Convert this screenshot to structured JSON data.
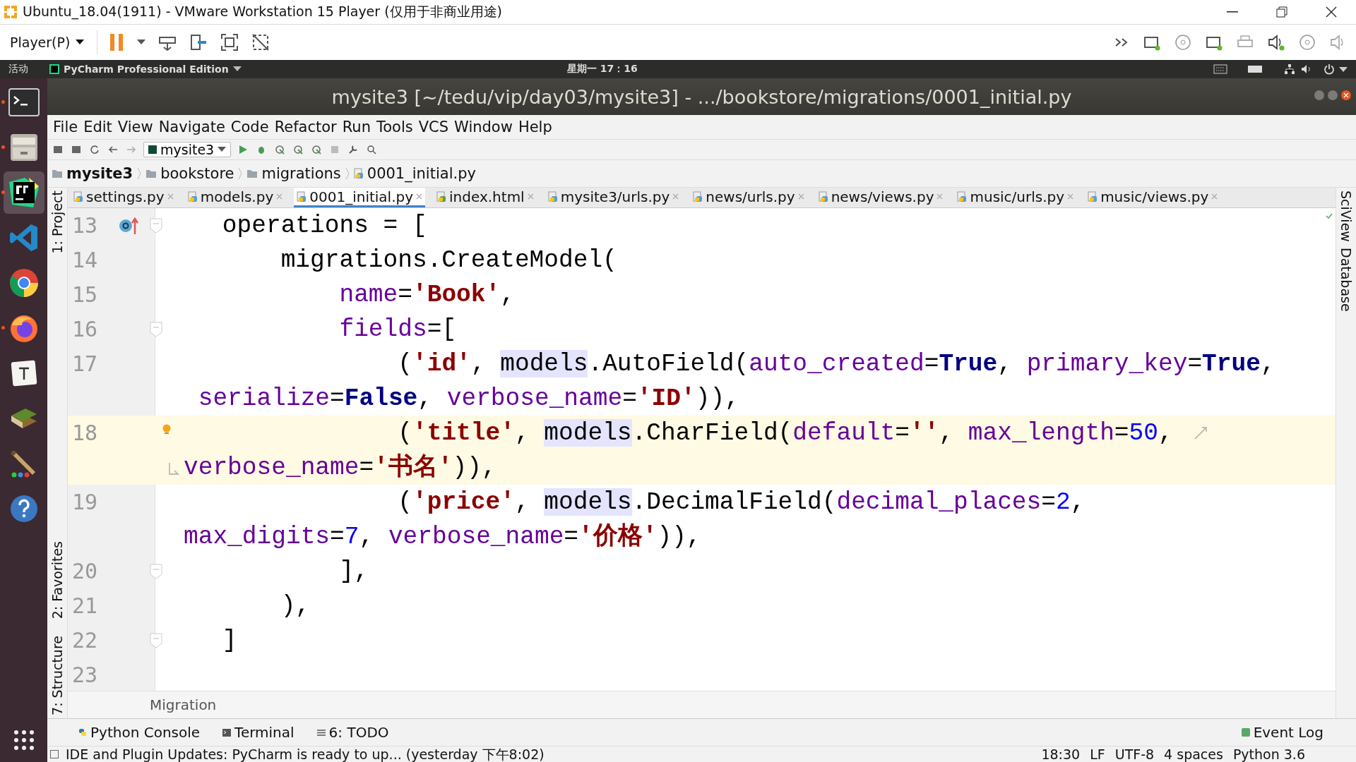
{
  "vm_window": {
    "title": "Ubuntu_18.04(1911) - VMware Workstation 15 Player (仅用于非商业用途)",
    "player_menu": "Player(P)",
    "paused": true
  },
  "ubuntu_bar": {
    "activities": "活动",
    "app_menu": "PyCharm Professional Edition",
    "clock": "星期一 17：16"
  },
  "dock": [
    {
      "kind": "terminal",
      "running": true,
      "selected": false
    },
    {
      "kind": "files",
      "running": true,
      "selected": false
    },
    {
      "kind": "pycharm",
      "running": true,
      "selected": true
    },
    {
      "kind": "vscode",
      "running": false,
      "selected": false
    },
    {
      "kind": "chrome",
      "running": false,
      "selected": false
    },
    {
      "kind": "firefox",
      "running": true,
      "selected": false
    },
    {
      "kind": "typora",
      "running": false,
      "selected": false
    },
    {
      "kind": "books",
      "running": false,
      "selected": false
    },
    {
      "kind": "brush",
      "running": false,
      "selected": false
    },
    {
      "kind": "help",
      "running": false,
      "selected": false
    }
  ],
  "ide": {
    "title": "mysite3 [~/tedu/vip/day03/mysite3] - .../bookstore/migrations/0001_initial.py",
    "menu": [
      "File",
      "Edit",
      "View",
      "Navigate",
      "Code",
      "Refactor",
      "Run",
      "Tools",
      "VCS",
      "Window",
      "Help"
    ],
    "run_config": "mysite3",
    "breadcrumb": [
      "mysite3",
      "bookstore",
      "migrations",
      "0001_initial.py"
    ],
    "tabs": [
      {
        "label": "settings.py",
        "selected": false
      },
      {
        "label": "models.py",
        "selected": false
      },
      {
        "label": "0001_initial.py",
        "selected": true
      },
      {
        "label": "index.html",
        "selected": false
      },
      {
        "label": "mysite3/urls.py",
        "selected": false
      },
      {
        "label": "news/urls.py",
        "selected": false
      },
      {
        "label": "news/views.py",
        "selected": false
      },
      {
        "label": "music/urls.py",
        "selected": false
      },
      {
        "label": "music/views.py",
        "selected": false
      }
    ],
    "left_tools": [
      "1: Project",
      "2: Favorites",
      "7: Structure"
    ],
    "right_tools": [
      "SciView",
      "Database"
    ],
    "lines": [
      {
        "number": "13",
        "current": false,
        "fold": true,
        "rows": [
          {
            "tokens": [
              {
                "kind": "text",
                "text": "    operations = ["
              }
            ]
          }
        ]
      },
      {
        "number": "14",
        "current": false,
        "fold": false,
        "rows": [
          {
            "tokens": [
              {
                "kind": "text",
                "text": "        migrations.CreateModel("
              }
            ]
          }
        ]
      },
      {
        "number": "15",
        "current": false,
        "fold": false,
        "rows": [
          {
            "tokens": [
              {
                "kind": "param",
                "text": "            name"
              },
              {
                "kind": "text",
                "text": "="
              },
              {
                "kind": "string",
                "text": "'Book'"
              },
              {
                "kind": "text",
                "text": ","
              }
            ]
          }
        ]
      },
      {
        "number": "16",
        "current": false,
        "fold": true,
        "rows": [
          {
            "tokens": [
              {
                "kind": "param",
                "text": "            fields"
              },
              {
                "kind": "text",
                "text": "=["
              }
            ]
          }
        ]
      },
      {
        "number": "17",
        "current": false,
        "fold": false,
        "rows": [
          {
            "tokens": [
              {
                "kind": "text",
                "text": "                ("
              },
              {
                "kind": "string",
                "text": "'id'"
              },
              {
                "kind": "text",
                "text": ", "
              },
              {
                "kind": "usage",
                "text": "models"
              },
              {
                "kind": "text",
                "text": ".AutoField("
              },
              {
                "kind": "param",
                "text": "auto_created"
              },
              {
                "kind": "text",
                "text": "="
              },
              {
                "kind": "constant",
                "text": "True"
              },
              {
                "kind": "text",
                "text": ", "
              },
              {
                "kind": "param",
                "text": "primary_key"
              },
              {
                "kind": "text",
                "text": "="
              },
              {
                "kind": "constant",
                "text": "True"
              },
              {
                "kind": "text",
                "text": ","
              }
            ]
          },
          {
            "tokens": [
              {
                "kind": "param",
                "text": " serialize"
              },
              {
                "kind": "text",
                "text": "="
              },
              {
                "kind": "constant",
                "text": "False"
              },
              {
                "kind": "text",
                "text": ", "
              },
              {
                "kind": "param",
                "text": "verbose_name"
              },
              {
                "kind": "text",
                "text": "="
              },
              {
                "kind": "string",
                "text": "'ID'"
              },
              {
                "kind": "text",
                "text": ")),"
              }
            ]
          }
        ]
      },
      {
        "number": "18",
        "current": true,
        "fold": false,
        "rows": [
          {
            "tokens": [
              {
                "kind": "text",
                "text": "                ("
              },
              {
                "kind": "string",
                "text": "'title'"
              },
              {
                "kind": "text",
                "text": ", "
              },
              {
                "kind": "usage",
                "text": "models"
              },
              {
                "kind": "text",
                "text": ".CharField("
              },
              {
                "kind": "param",
                "text": "default"
              },
              {
                "kind": "text",
                "text": "="
              },
              {
                "kind": "string",
                "text": "''"
              },
              {
                "kind": "text",
                "text": ", "
              },
              {
                "kind": "param",
                "text": "max_length"
              },
              {
                "kind": "text",
                "text": "="
              },
              {
                "kind": "number",
                "text": "50"
              },
              {
                "kind": "text",
                "text": ","
              }
            ]
          },
          {
            "tokens": [
              {
                "kind": "param",
                "text": "verbose_name"
              },
              {
                "kind": "text",
                "text": "="
              },
              {
                "kind": "string",
                "text": "'书名'"
              },
              {
                "kind": "text",
                "text": ")),"
              }
            ]
          }
        ]
      },
      {
        "number": "19",
        "current": false,
        "fold": false,
        "rows": [
          {
            "tokens": [
              {
                "kind": "text",
                "text": "                ("
              },
              {
                "kind": "string",
                "text": "'price'"
              },
              {
                "kind": "text",
                "text": ", "
              },
              {
                "kind": "usage",
                "text": "models"
              },
              {
                "kind": "text",
                "text": ".DecimalField("
              },
              {
                "kind": "param",
                "text": "decimal_places"
              },
              {
                "kind": "text",
                "text": "="
              },
              {
                "kind": "number",
                "text": "2"
              },
              {
                "kind": "text",
                "text": ","
              }
            ]
          },
          {
            "tokens": [
              {
                "kind": "param",
                "text": "max_digits"
              },
              {
                "kind": "text",
                "text": "="
              },
              {
                "kind": "number",
                "text": "7"
              },
              {
                "kind": "text",
                "text": ", "
              },
              {
                "kind": "param",
                "text": "verbose_name"
              },
              {
                "kind": "text",
                "text": "="
              },
              {
                "kind": "string",
                "text": "'价格'"
              },
              {
                "kind": "text",
                "text": ")),"
              }
            ]
          }
        ]
      },
      {
        "number": "20",
        "current": false,
        "fold": true,
        "rows": [
          {
            "tokens": [
              {
                "kind": "text",
                "text": "            ],"
              }
            ]
          }
        ]
      },
      {
        "number": "21",
        "current": false,
        "fold": false,
        "rows": [
          {
            "tokens": [
              {
                "kind": "text",
                "text": "        ),"
              }
            ]
          }
        ]
      },
      {
        "number": "22",
        "current": false,
        "fold": true,
        "rows": [
          {
            "tokens": [
              {
                "kind": "text",
                "text": "    ]"
              }
            ]
          }
        ]
      },
      {
        "number": "23",
        "current": false,
        "fold": false,
        "rows": [
          {
            "tokens": []
          }
        ]
      }
    ],
    "code_breadcrumb": "Migration",
    "tool_windows": [
      {
        "kind": "console",
        "label": "Python Console"
      },
      {
        "kind": "terminal",
        "label": "Terminal"
      },
      {
        "kind": "todo",
        "label": "6: TODO"
      }
    ],
    "event_log": "Event Log",
    "status_message": "IDE and Plugin Updates: PyCharm is ready to up... (yesterday 下午8:02)",
    "status_items": [
      "18:30",
      "LF",
      "UTF-8",
      "4 spaces",
      "Python 3.6"
    ]
  }
}
